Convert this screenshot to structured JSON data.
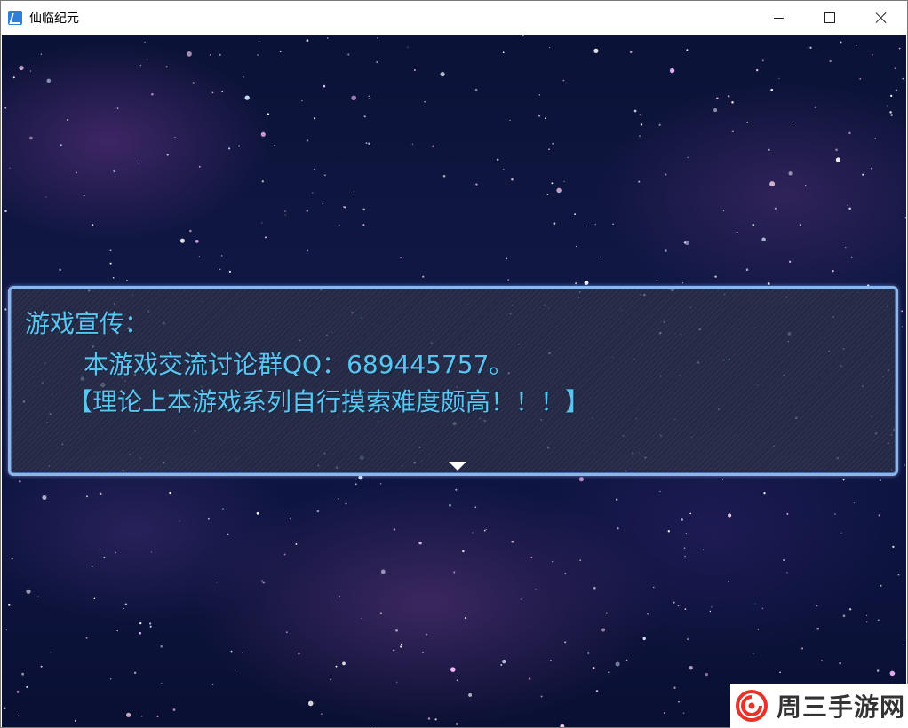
{
  "window": {
    "title": "仙临纪元",
    "icon": "app-icon",
    "controls": [
      "minimize-icon",
      "maximize-icon",
      "close-icon"
    ]
  },
  "dialog": {
    "speaker_line": "游戏宣传：",
    "line2": "本游戏交流讨论群QQ：689445757。",
    "line3": "【理论上本游戏系列自行摸索难度颇高！！！】",
    "advance_icon": "down-triangle-icon",
    "text_color": "#59c6f2",
    "border_color": "#8fb6ea"
  },
  "watermark": {
    "text": "周三手游网",
    "logo_icon": "swirl-logo-icon",
    "logo_color": "#e8332a"
  }
}
